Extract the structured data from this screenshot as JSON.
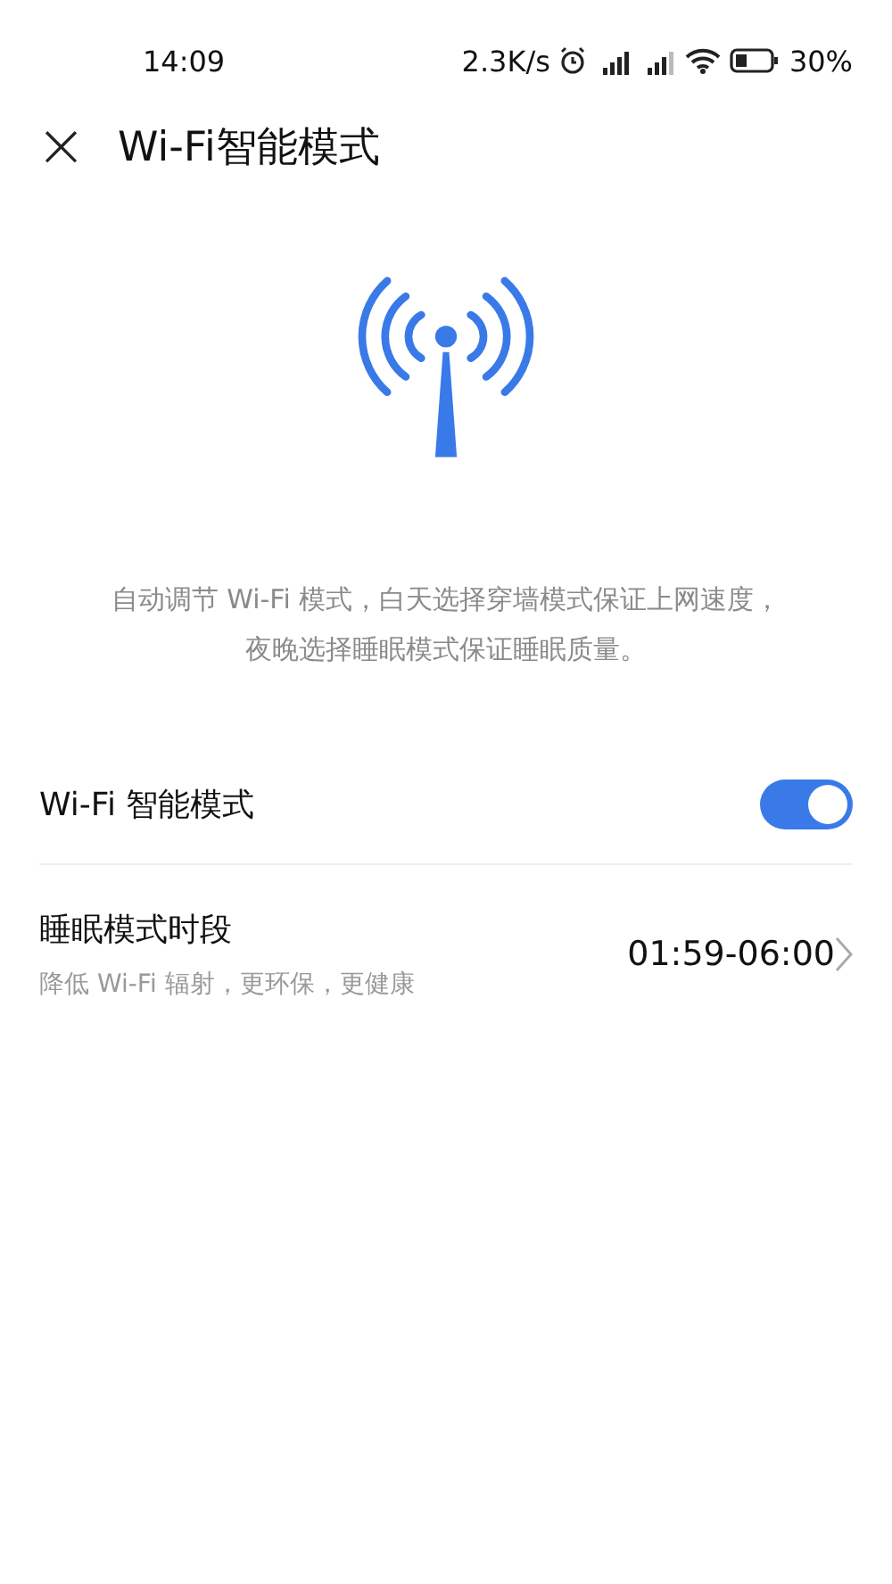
{
  "status_bar": {
    "time": "14:09",
    "net_speed": "2.3K/s",
    "battery_text": "30%"
  },
  "header": {
    "close": "×",
    "title": "Wi-Fi智能模式"
  },
  "description": "自动调节 Wi-Fi 模式，白天选择穿墙模式保证上网速度，夜晚选择睡眠模式保证睡眠质量。",
  "settings": [
    {
      "kind": "switch",
      "label": "Wi-Fi 智能模式",
      "on": true
    },
    {
      "kind": "link",
      "label": "睡眠模式时段",
      "subtitle": "降低 Wi-Fi 辐射，更环保，更健康",
      "value": "01:59-06:00"
    }
  ]
}
